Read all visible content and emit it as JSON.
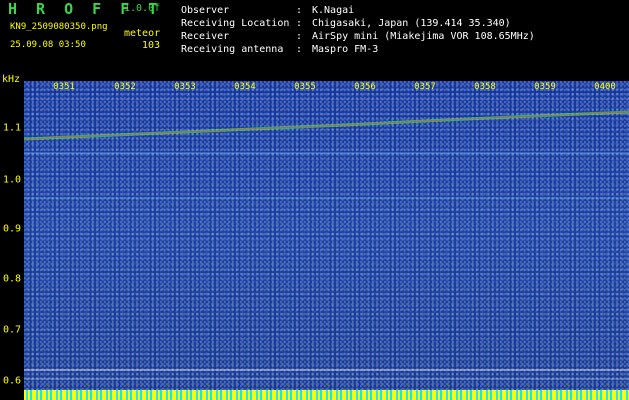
{
  "header": {
    "title": "H R O F F T",
    "version": "1.0.0f",
    "filename": "KN9_2509080350.png",
    "event_type": "meteor",
    "datetime": "25.09.08 03:50",
    "count": "103",
    "observer_label": "Observer",
    "observer_value": "K.Nagai",
    "location_label": "Receiving Location",
    "location_value": "Chigasaki, Japan (139.414 35.340)",
    "receiver_label": "Receiver",
    "receiver_value": "AirSpy mini (Miakejima VOR 108.65MHz)",
    "antenna_label": "Receiving antenna",
    "antenna_value": "Maspro FM-3"
  },
  "axis": {
    "unit": "kHz",
    "y_ticks": [
      "1.1",
      "1.0",
      "0.9",
      "0.8",
      "0.7",
      "0.6"
    ],
    "x_ticks": [
      "0351",
      "0352",
      "0353",
      "0354",
      "0355",
      "0356",
      "0357",
      "0358",
      "0359",
      "0400"
    ]
  },
  "colors": {
    "background": "#000000",
    "header_green": "#39d64a",
    "header_yellow": "#ffff00",
    "waterfall_blue": "#1d3fa0",
    "signal_red": "#ff3b3b",
    "signal_green": "#3cff58",
    "bottom_cyan": "#29e6ff"
  }
}
